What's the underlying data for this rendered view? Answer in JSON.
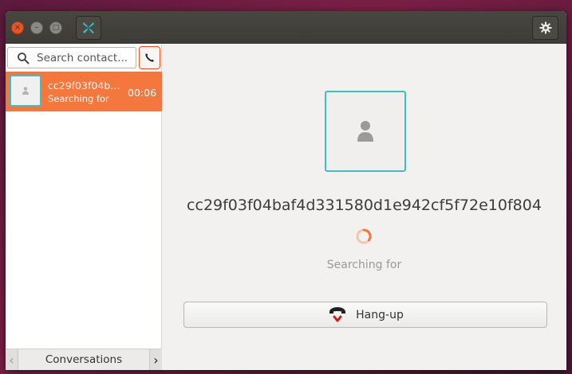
{
  "titlebar": {
    "close_glyph": "×",
    "minimize_glyph": "–",
    "maximize_glyph": "□",
    "app_icon": "ring-logo-icon",
    "settings_icon": "gear-icon"
  },
  "sidebar": {
    "search": {
      "placeholder": "Search contact...",
      "value": ""
    },
    "call_button_icon": "phone-icon",
    "conversations": [
      {
        "name": "cc29f03f04baf4d331580d1e942cf5f72e10f804",
        "status": "Searching for",
        "time": "00:06",
        "selected": true
      }
    ],
    "bottom_tab": {
      "label": "Conversations",
      "left_arrow": "‹",
      "right_arrow": "›"
    }
  },
  "call": {
    "peer_name": "cc29f03f04baf4d331580d1e942cf5f72e10f804",
    "status": "Searching for",
    "hangup_label": "Hang-up"
  },
  "colors": {
    "accent": "#f4773d",
    "avatar_border": "#3dbfc7",
    "close_button": "#e95420",
    "hangup_red": "#cc1b1b"
  }
}
